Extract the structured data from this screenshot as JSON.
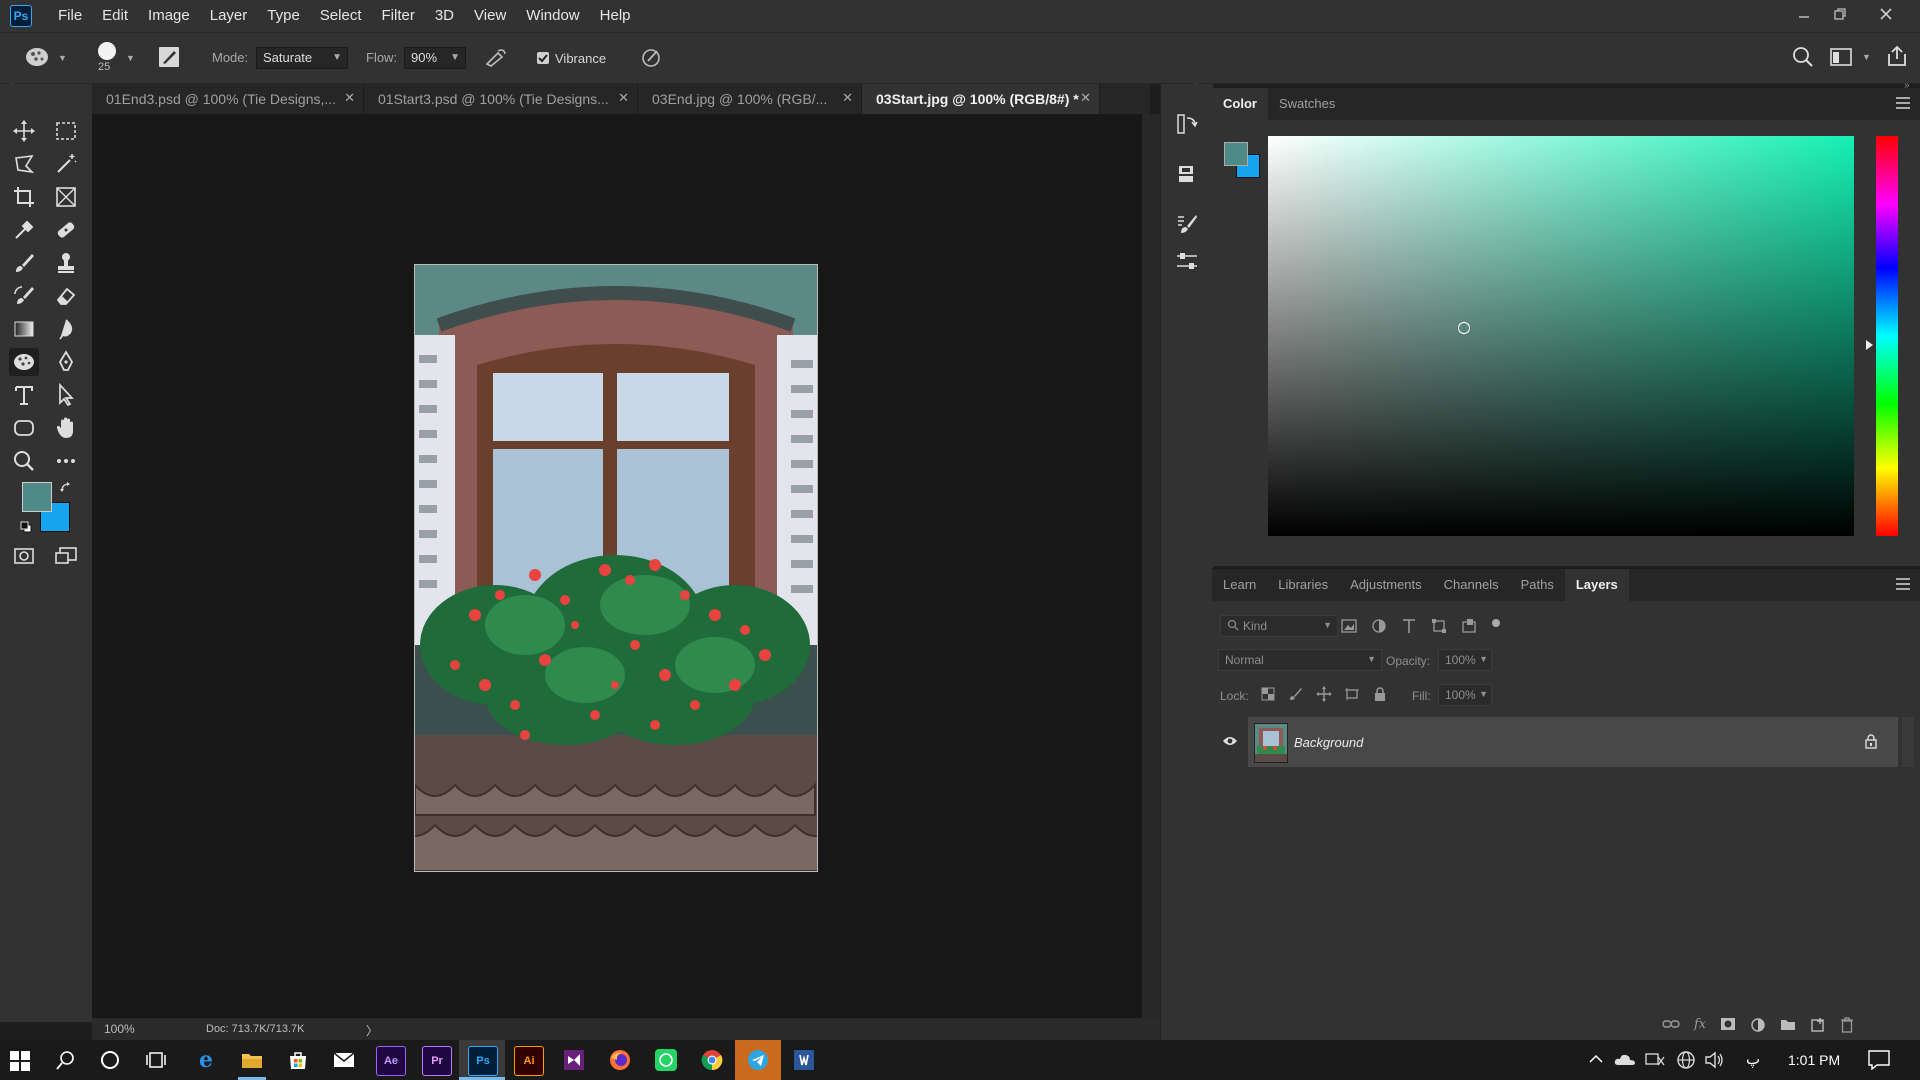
{
  "app": {
    "logo": "Ps"
  },
  "menu": [
    "File",
    "Edit",
    "Image",
    "Layer",
    "Type",
    "Select",
    "Filter",
    "3D",
    "View",
    "Window",
    "Help"
  ],
  "options": {
    "brush_size": "25",
    "mode_label": "Mode:",
    "mode_value": "Saturate",
    "flow_label": "Flow:",
    "flow_value": "90%",
    "vibrance_label": "Vibrance",
    "vibrance_checked": true
  },
  "tabs": [
    {
      "label": "01End3.psd @ 100% (Tie Designs,...",
      "active": false
    },
    {
      "label": "01Start3.psd @ 100% (Tie Designs...",
      "active": false
    },
    {
      "label": "03End.jpg @ 100% (RGB/...",
      "active": false
    },
    {
      "label": "03Start.jpg @ 100% (RGB/8#) *",
      "active": true
    }
  ],
  "tools": {
    "foreground_color": "#4f8a86",
    "background_color": "#16a3ef"
  },
  "status": {
    "zoom": "100%",
    "doc": "Doc: 713.7K/713.7K",
    "arrow": "〉"
  },
  "color_panel": {
    "tabs": [
      "Color",
      "Swatches"
    ],
    "active_tab": "Color",
    "hue_color": "#16f0b4"
  },
  "layers_panel": {
    "tabs": [
      "Learn",
      "Libraries",
      "Adjustments",
      "Channels",
      "Paths",
      "Layers"
    ],
    "active_tab": "Layers",
    "filter_placeholder": "Kind",
    "blend_mode": "Normal",
    "opacity_label": "Opacity:",
    "opacity_value": "100%",
    "lock_label": "Lock:",
    "fill_label": "Fill:",
    "fill_value": "100%",
    "layers": [
      {
        "name": "Background",
        "visible": true,
        "locked": true
      }
    ]
  },
  "taskbar": {
    "apps": [
      "Ae",
      "Pr",
      "Ps",
      "Ai"
    ],
    "time": "1:01 PM",
    "lang": "پ"
  }
}
